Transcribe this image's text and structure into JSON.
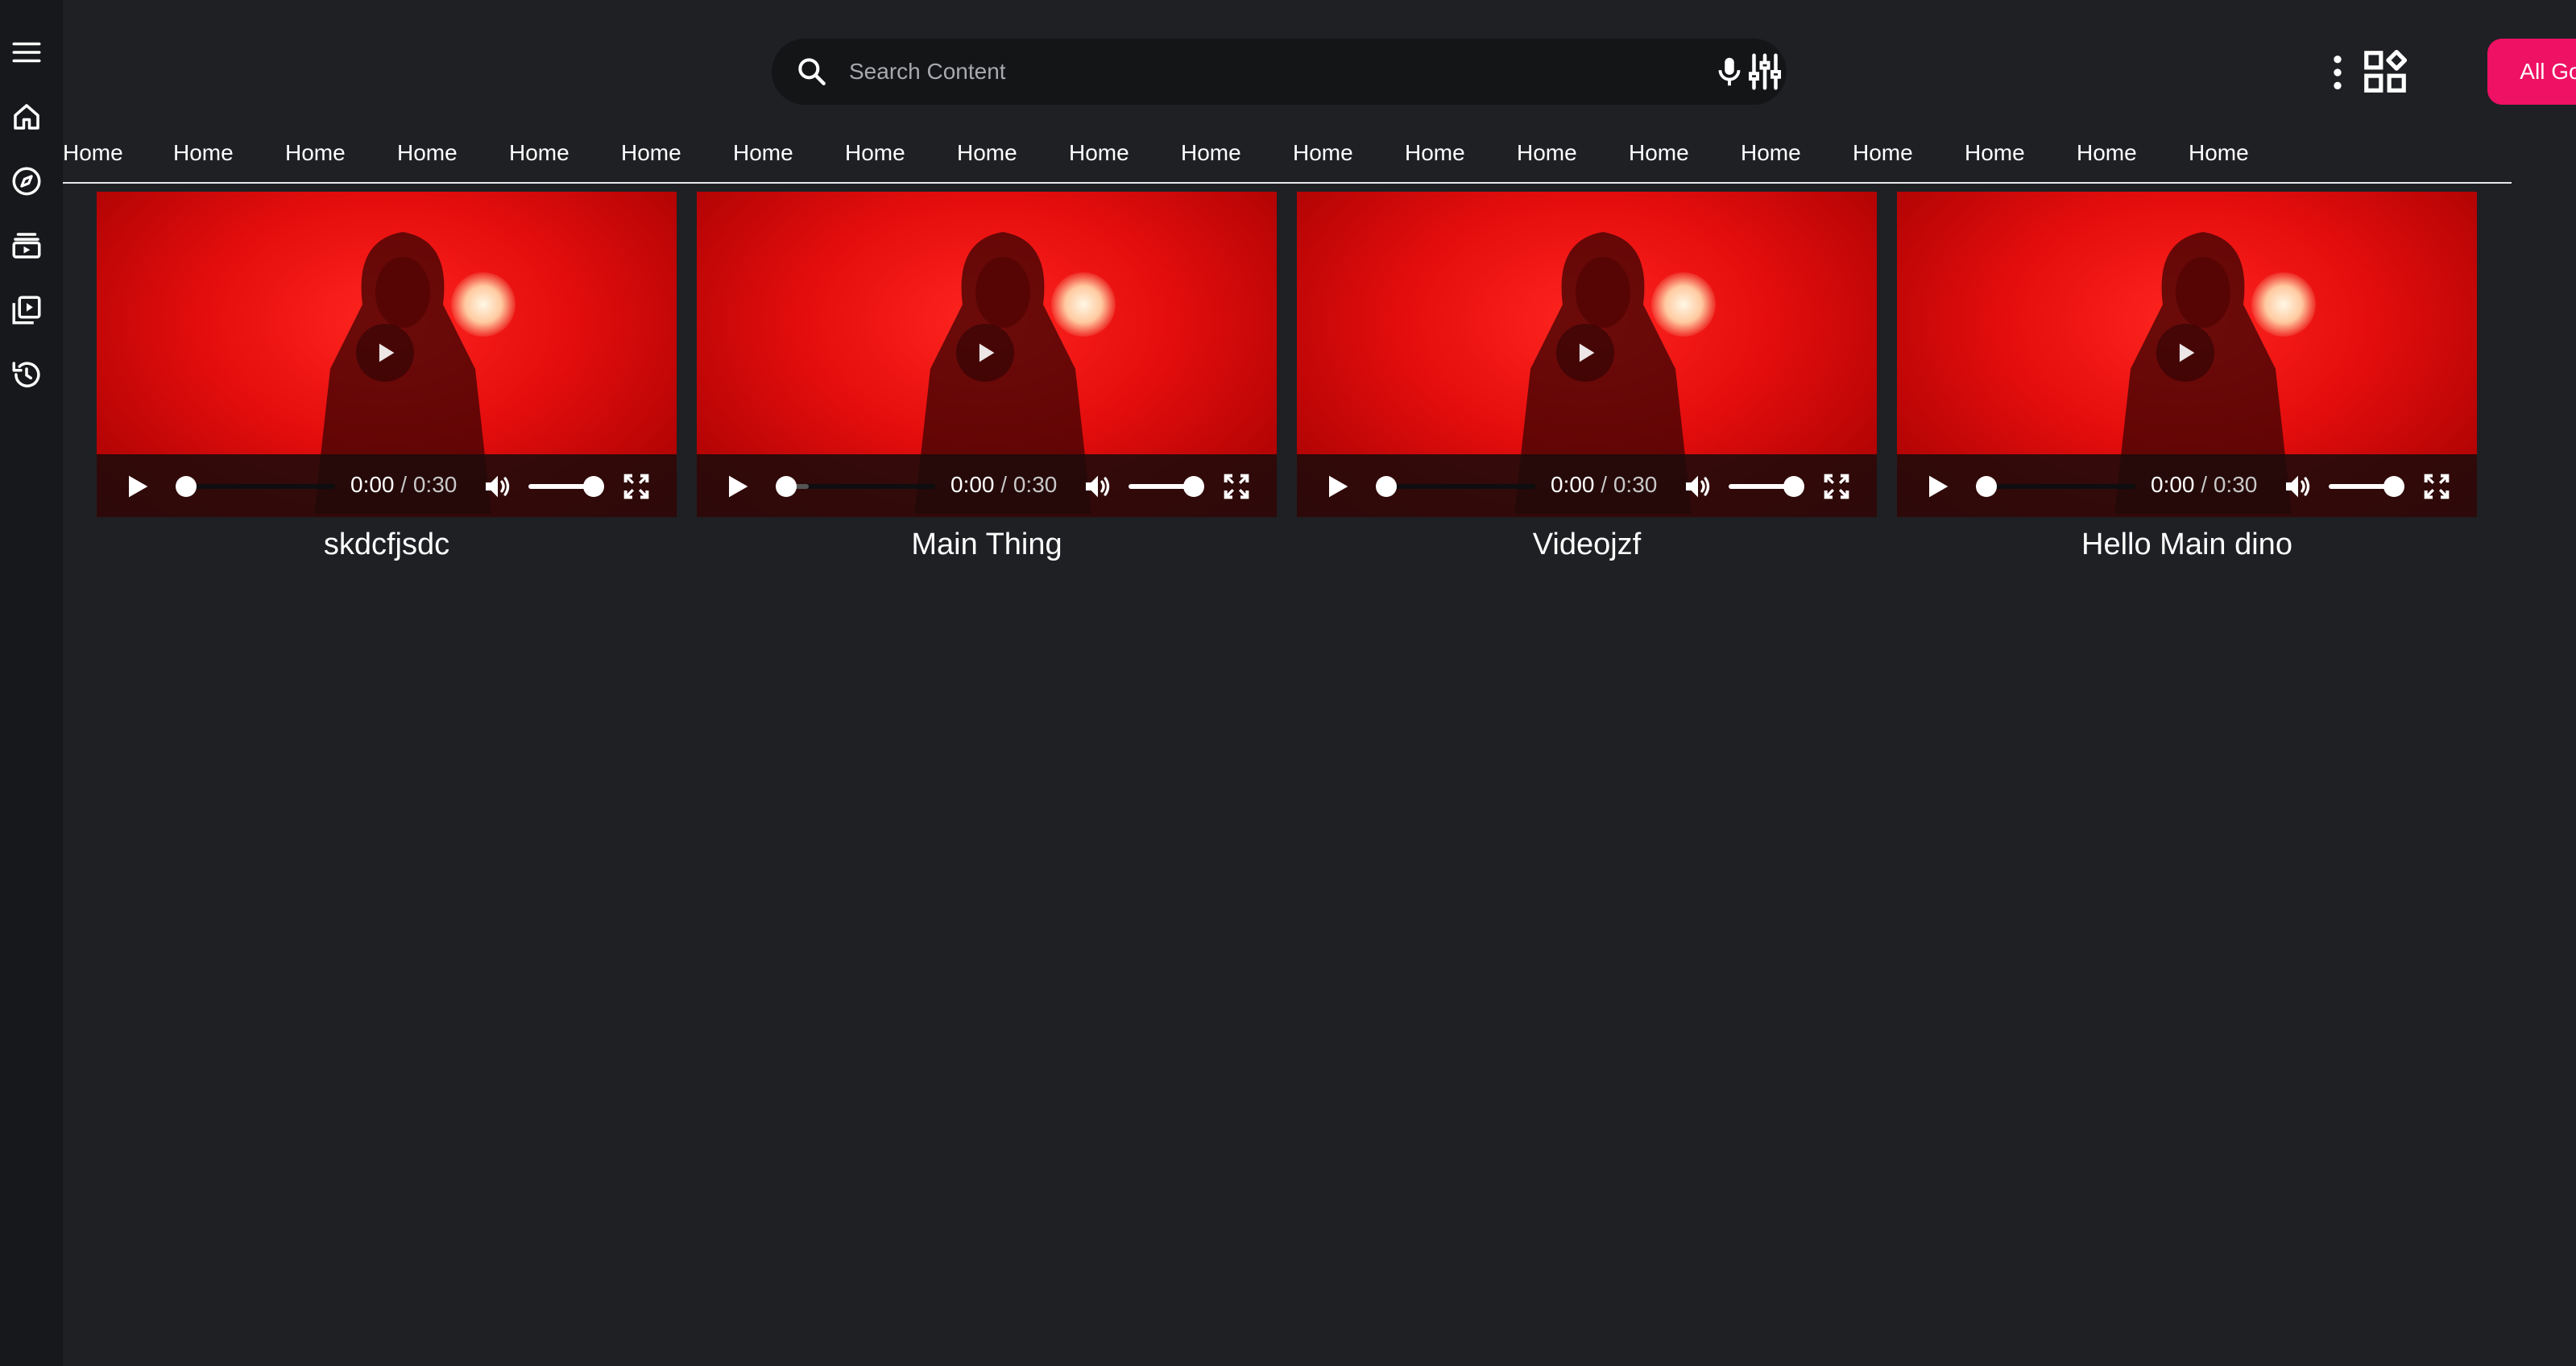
{
  "sidebar": {
    "icons": [
      "menu-icon",
      "home-icon",
      "compass-icon",
      "subscriptions-icon",
      "library-icon",
      "history-icon"
    ]
  },
  "header": {
    "search_placeholder": "Search Content",
    "cta_label": "All Good",
    "accent_color": "#ee1164"
  },
  "tabs": [
    "Home",
    "Home",
    "Home",
    "Home",
    "Home",
    "Home",
    "Home",
    "Home",
    "Home",
    "Home",
    "Home",
    "Home",
    "Home",
    "Home",
    "Home",
    "Home",
    "Home",
    "Home",
    "Home",
    "Home"
  ],
  "videos": [
    {
      "title": "skdcfjsdc",
      "current": "0:00",
      "duration": "/ 0:30",
      "buffered": 0
    },
    {
      "title": "Main Thing",
      "current": "0:00",
      "duration": "/ 0:30",
      "buffered": 0.2
    },
    {
      "title": "Videojzf",
      "current": "0:00",
      "duration": "/ 0:30",
      "buffered": 0.1
    },
    {
      "title": "Hello Main dino",
      "current": "0:00",
      "duration": "/ 0:30",
      "buffered": 0
    }
  ]
}
